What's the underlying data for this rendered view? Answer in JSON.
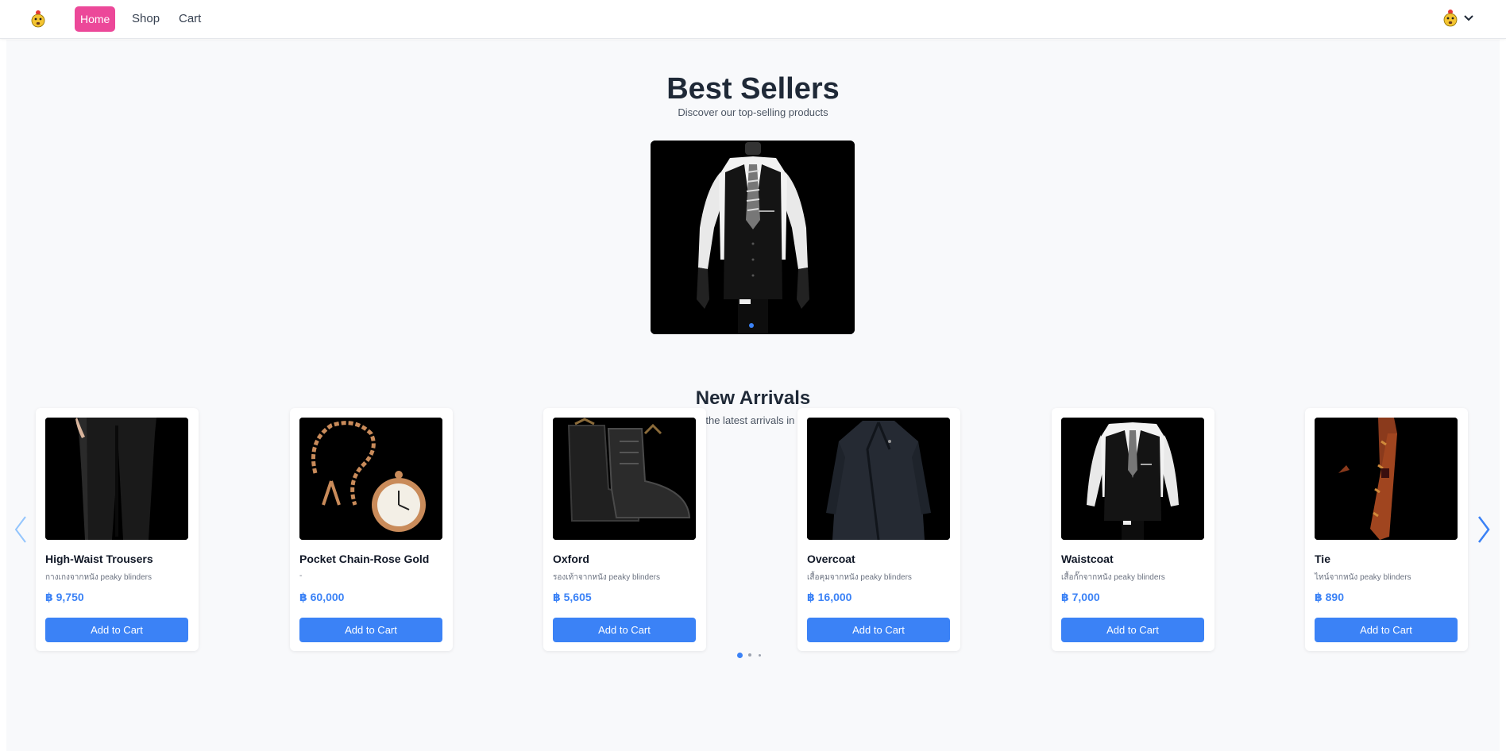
{
  "nav": {
    "logo_icon": "bee-emoji-icon",
    "links": [
      {
        "label": "Home",
        "active": true
      },
      {
        "label": "Shop",
        "active": false
      },
      {
        "label": "Cart",
        "active": false
      }
    ],
    "active_color": "#ec4899"
  },
  "best_sellers": {
    "title": "Best Sellers",
    "subtitle": "Discover our top-selling products",
    "slide_image": "waistcoat-on-mannequin",
    "slide_count": 1,
    "active_slide": 1
  },
  "new_arrivals": {
    "title": "New Arrivals",
    "subtitle": "Explore the latest arrivals in our store",
    "products": [
      {
        "name": "High-Waist Trousers",
        "desc": "กางเกงจากหนัง peaky blinders",
        "price": "฿ 9,750",
        "button": "Add to Cart",
        "image": "trousers"
      },
      {
        "name": "Pocket Chain-Rose Gold",
        "desc": "-",
        "price": "฿ 60,000",
        "button": "Add to Cart",
        "image": "pocket-watch"
      },
      {
        "name": "Oxford",
        "desc": "รองเท้าจากหนัง peaky blinders",
        "price": "฿ 5,605",
        "button": "Add to Cart",
        "image": "boots"
      },
      {
        "name": "Overcoat",
        "desc": "เสื้อคุมจากหนัง peaky blinders",
        "price": "฿ 16,000",
        "button": "Add to Cart",
        "image": "overcoat"
      },
      {
        "name": "Waistcoat",
        "desc": "เสื้อกั๊กจากหนัง peaky blinders",
        "price": "฿ 7,000",
        "button": "Add to Cart",
        "image": "waistcoat"
      },
      {
        "name": "Tie",
        "desc": "ไทน์จากหนัง peaky blinders",
        "price": "฿ 890",
        "button": "Add to Cart",
        "image": "tie"
      }
    ],
    "page_count": 3,
    "active_page": 1
  },
  "colors": {
    "accent": "#3b82f6",
    "background": "#f8f9fb"
  }
}
